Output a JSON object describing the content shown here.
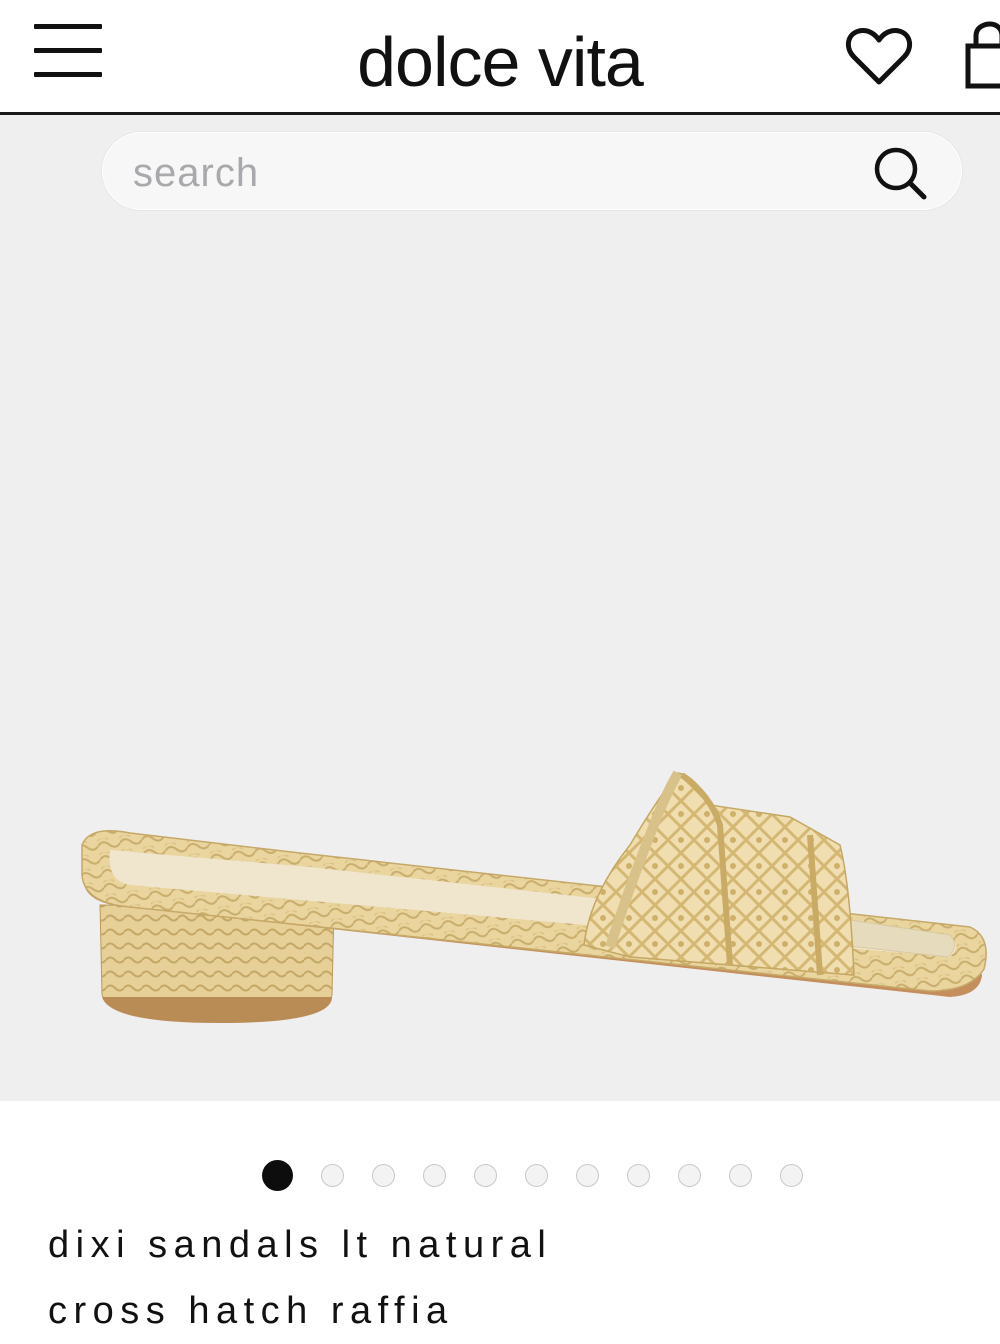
{
  "header": {
    "brand": "dolce vita",
    "menu_icon": "hamburger-menu-icon",
    "wishlist_icon": "heart-icon",
    "bag_icon": "shopping-bag-icon"
  },
  "search": {
    "placeholder": "search",
    "value": "",
    "icon": "search-icon"
  },
  "gallery": {
    "image": "raffia slide sandal with block heel",
    "slide_count": 11,
    "active_index": 0
  },
  "product": {
    "name_line1": "dixi sandals lt natural",
    "name_line2": "cross hatch raffia"
  },
  "colors": {
    "hero_background": "#efeff0",
    "raffia": "#e9d39a",
    "text": "#111111"
  }
}
